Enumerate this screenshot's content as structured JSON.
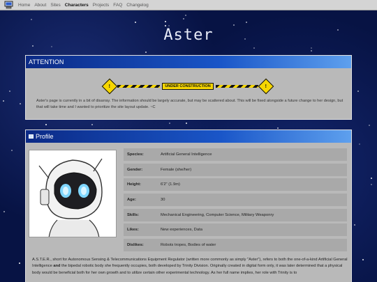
{
  "nav": {
    "logo_icon": "computer-icon",
    "links": [
      "Home",
      "About",
      "Sites",
      "Characters",
      "Projects",
      "FAQ",
      "Changelog"
    ],
    "active": "Characters"
  },
  "page_title": "Aster",
  "attention": {
    "title": "ATTENTION",
    "banner_label": "UNDER CONSTRUCTION",
    "message": "Aster's page is currently in a bit of disarray. The information should be largely accurate, but may be scattered about. This will be fixed alongside a future change to her design, but that will take time and I wanted to prioritize the site layout update. ~C"
  },
  "profile": {
    "title": "Profile",
    "portrait_icon": "robot-portrait",
    "rows": [
      {
        "key": "Species:",
        "value": "Artificial General Intelligence"
      },
      {
        "key": "Gender:",
        "value": "Female (she/her)"
      },
      {
        "key": "Height:",
        "value": "6'2\" (1.9m)"
      },
      {
        "key": "Age:",
        "value": "30"
      },
      {
        "key": "Skills:",
        "value": "Mechanical Engineering, Computer Science, Military Weaponry"
      },
      {
        "key": "Likes:",
        "value": "New experiences, Data"
      },
      {
        "key": "Dislikes:",
        "value": "Robots tropes, Bodies of water"
      }
    ],
    "bio_part1": "A.S.T.E.R., short for Autonomous Sensing & Telecommunications Equipment Regulator (written more commonly as simply \"Aster\"), refers to both the one-of-a-kind Artificial General Intelligence ",
    "bio_and": "and",
    "bio_part2": " the bipedal robotic body she frequently occupies, both developed by Trinity Division. Originally created in digital form only, it was later determined that a physical body would be beneficial both for her own growth and to utilize certain other experimental technology. As her full name implies, her role with Trinity is to"
  },
  "colors": {
    "header_gradient_start": "#0b2a86",
    "header_gradient_end": "#5ea0ee",
    "panel_bg": "#b9b9b9",
    "hazard_yellow": "#f6d600"
  }
}
